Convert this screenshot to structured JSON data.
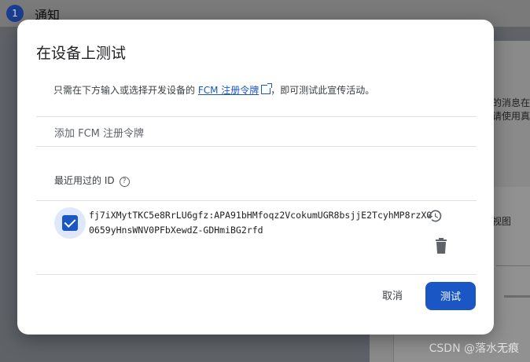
{
  "background": {
    "step_number": "1",
    "step_title": "通知",
    "snippet_line1": "的消息在",
    "snippet_line2": "请使用真",
    "snippet_line3": "视图"
  },
  "dialog": {
    "title": "在设备上测试",
    "description_prefix": "只需在下方输入或选择开发设备的 ",
    "description_link": "FCM 注册令牌",
    "description_suffix": "，即可测试此宣传活动。",
    "add_token_label": "添加 FCM 注册令牌",
    "recent_ids_label": "最近用过的 ID",
    "help_glyph": "?",
    "recent_token": "fj7iXMytTKC5e8RrLU6gfz:APA91bHMfoqz2VcokumUGR8bsjjE2TcyhMP8rzX00659yHnsWNV0PFbXewdZ-GDHmiBG2rfd",
    "cancel_label": "取消",
    "test_label": "测试"
  },
  "watermark": "CSDN @落水无痕",
  "colors": {
    "accent": "#1a56c4",
    "checkbox_halo": "#dfe8fb"
  }
}
